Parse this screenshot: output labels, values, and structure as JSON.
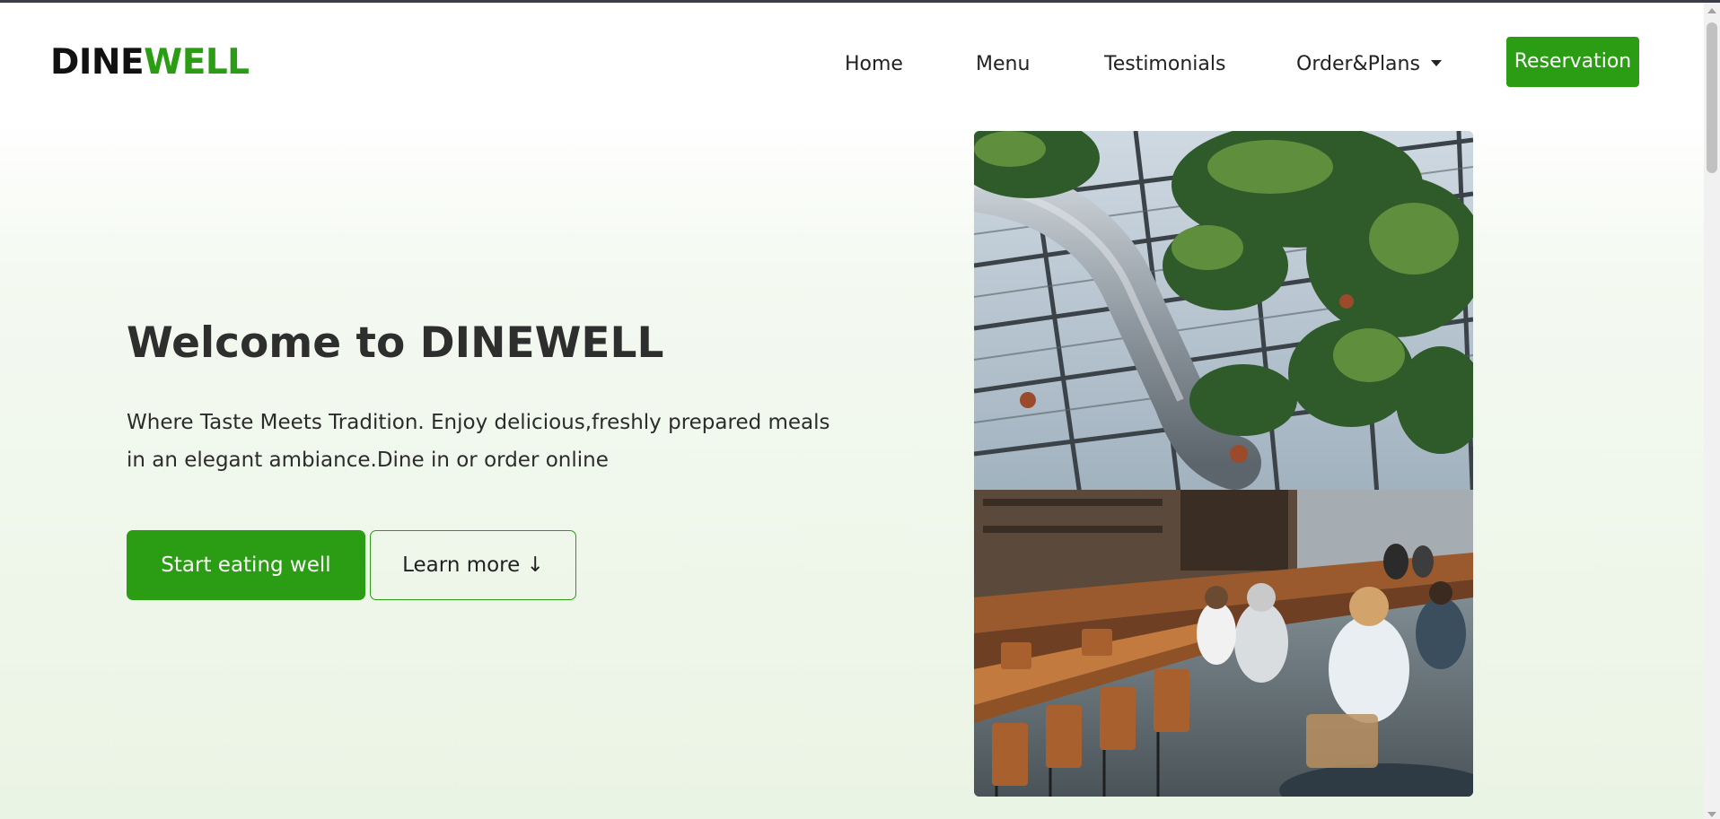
{
  "brand": {
    "logo_part1": "DINE",
    "logo_part2": "WELL",
    "accent_color": "#2a9d14"
  },
  "nav": {
    "items": [
      {
        "label": "Home"
      },
      {
        "label": "Menu"
      },
      {
        "label": "Testimonials"
      },
      {
        "label": "Order&Plans",
        "has_dropdown": true
      }
    ],
    "reservation_label": "Reservation"
  },
  "hero": {
    "title": "Welcome to DINEWELL",
    "description_line1": "Where Taste Meets Tradition. Enjoy delicious,freshly prepared meals",
    "description_line2": "in an elegant ambiance.Dine in or order online",
    "primary_button": "Start eating well",
    "secondary_button": "Learn more ↓",
    "image_icon": "restaurant-greenhouse-photo"
  }
}
